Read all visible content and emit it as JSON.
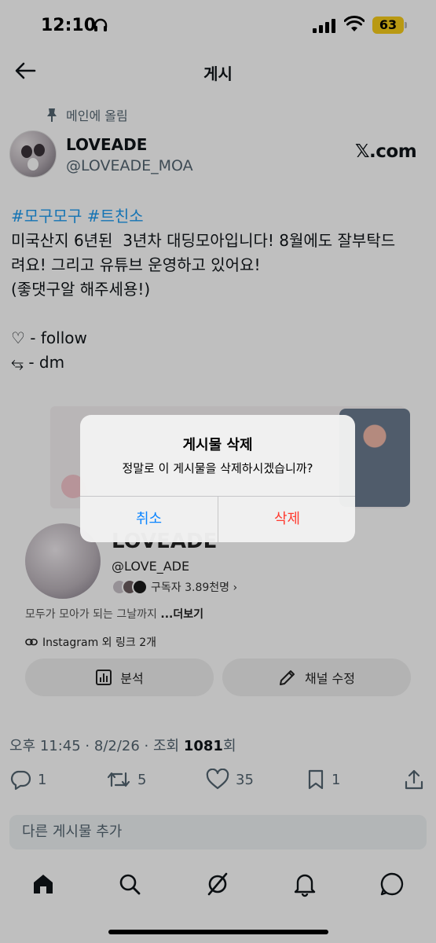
{
  "status_bar": {
    "time": "12:10",
    "battery": "63"
  },
  "header": {
    "title": "게시"
  },
  "post": {
    "pinned_label": "메인에 올림",
    "author_name": "LOVEADE",
    "author_handle": "@LOVEADE_MOA",
    "source_label": "𝕏.com",
    "hashtags": "#모구모구 #트친소",
    "body": "미국산지 6년된  3년차 대딩모아입니다! 8월에도 잘부탁드\n려요! 그리고 유튜브 운영하고 있어요!\n(좋댓구알 해주세용!)\n\n♡ - follow\n⥃ - dm"
  },
  "media_card": {
    "channel_title": "LOVEADE",
    "channel_handle": "@LOVE_ADE",
    "subscribers": "구독자 3.89천명 ›",
    "description": "모두가 모아가 되는 그날까지 ",
    "more": "...더보기",
    "link": "Instagram 외 링크 2개",
    "analytics_button": "분석",
    "edit_button": "채널 수정"
  },
  "dialog": {
    "title": "게시물 삭제",
    "message": "정말로 이 게시물을 삭제하시겠습니까?",
    "cancel": "취소",
    "confirm": "삭제"
  },
  "meta": {
    "timestamp": "오후 11:45 · 8/2/26 · 조회 ",
    "views": "1081",
    "views_suffix": "회"
  },
  "actions": {
    "replies": "1",
    "reposts": "5",
    "likes": "35",
    "bookmarks": "1"
  },
  "compose": {
    "placeholder": "다른 게시물 추가"
  },
  "tabbar": {
    "items": [
      "home-icon",
      "search-icon",
      "grok-icon",
      "notifications-icon",
      "messages-icon"
    ]
  }
}
